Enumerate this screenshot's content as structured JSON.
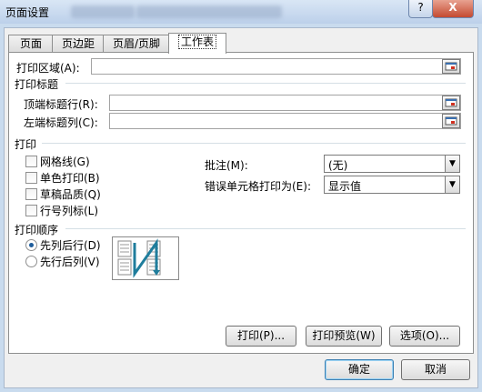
{
  "window": {
    "title": "页面设置",
    "help_label": "?",
    "close_label": "X"
  },
  "tabs": [
    {
      "label": "页面"
    },
    {
      "label": "页边距"
    },
    {
      "label": "页眉/页脚"
    },
    {
      "label": "工作表"
    }
  ],
  "active_tab": "工作表",
  "print_area": {
    "label": "打印区域(A):",
    "value": ""
  },
  "print_titles": {
    "heading": "打印标题",
    "rows_label": "顶端标题行(R):",
    "rows_value": "",
    "cols_label": "左端标题列(C):",
    "cols_value": ""
  },
  "print": {
    "heading": "打印",
    "options": [
      {
        "label": "网格线(G)",
        "checked": false
      },
      {
        "label": "单色打印(B)",
        "checked": false
      },
      {
        "label": "草稿品质(Q)",
        "checked": false
      },
      {
        "label": "行号列标(L)",
        "checked": false
      }
    ],
    "comments_label": "批注(M):",
    "comments_value": "(无)",
    "errors_label": "错误单元格打印为(E):",
    "errors_value": "显示值"
  },
  "page_order": {
    "heading": "打印顺序",
    "options": [
      {
        "label": "先列后行(D)",
        "selected": true
      },
      {
        "label": "先行后列(V)",
        "selected": false
      }
    ]
  },
  "buttons": {
    "print": "打印(P)...",
    "preview": "打印预览(W)",
    "options": "选项(O)...",
    "ok": "确定",
    "cancel": "取消"
  },
  "colors": {
    "titlebar": "#bcd0ea",
    "close_button": "#c44a30",
    "radio_dot": "#1e5d9c",
    "preview_arrow": "#1f7d9c"
  },
  "icons": {
    "collapse": "range-selector-icon",
    "dropdown": "chevron-down-icon"
  }
}
